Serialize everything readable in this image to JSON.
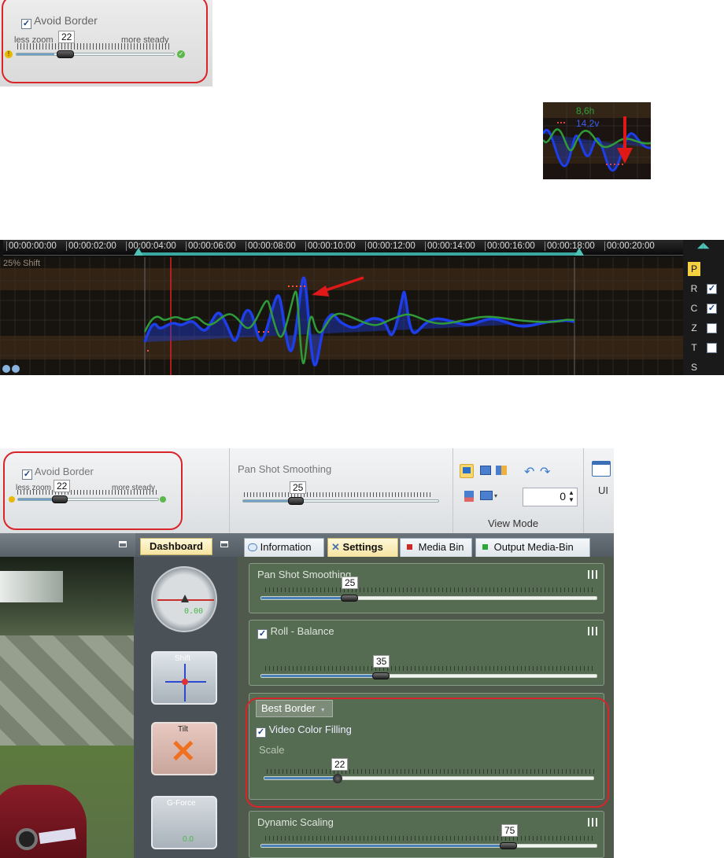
{
  "top_snippet": {
    "checkbox_label": "Avoid Border",
    "left_label": "less zoom",
    "right_label": "more steady",
    "value": "22",
    "value_fraction": 0.24
  },
  "thumb_graph": {
    "h_value": "8,6h",
    "v_value": "14,2v"
  },
  "timeline": {
    "times": [
      "00:00:00:00",
      "00:00:02:00",
      "00:00:04:00",
      "00:00:06:00",
      "00:00:08:00",
      "00:00:10:00",
      "00:00:12:00",
      "00:00:14:00",
      "00:00:16:00",
      "00:00:18:00",
      "00:00:20:00"
    ],
    "shift_label": "25% Shift",
    "side_items": [
      {
        "letter": "P",
        "checked": null,
        "active": true
      },
      {
        "letter": "R",
        "checked": true,
        "active": false
      },
      {
        "letter": "C",
        "checked": true,
        "active": false
      },
      {
        "letter": "Z",
        "checked": false,
        "active": false
      },
      {
        "letter": "T",
        "checked": false,
        "active": false
      },
      {
        "letter": "S",
        "checked": null,
        "active": false
      }
    ],
    "colors": {
      "green": "#2e9a3a",
      "blue": "#1d3ee8",
      "red": "#e02020"
    }
  },
  "toolbar": {
    "avoid_border": {
      "label": "Avoid Border",
      "left": "less zoom",
      "right": "more steady",
      "value": "22",
      "fraction": 0.24
    },
    "pan_shot": {
      "title": "Pan Shot Smoothing",
      "value": "25",
      "fraction": 0.27
    },
    "view_mode_label": "View Mode",
    "counter_value": "0",
    "ui_label": "UI"
  },
  "dashboard": {
    "tab_label": "Dashboard",
    "gauge_readout": "0.00",
    "shift_label": "Shift",
    "tilt_label": "Tilt",
    "gforce_label": "G-Force",
    "gforce_readout": "0.0"
  },
  "tabs": [
    {
      "label": "Information",
      "icon": "speech-bubble-icon"
    },
    {
      "label": "Settings",
      "icon": "tools-icon"
    },
    {
      "label": "Media Bin",
      "icon": "red-square-icon"
    },
    {
      "label": "Output Media-Bin",
      "icon": "green-square-icon"
    }
  ],
  "settings": {
    "pan_shot": {
      "title": "Pan Shot Smoothing",
      "value": "25",
      "fraction": 0.25
    },
    "roll_balance": {
      "title": "Roll - Balance",
      "value": "35",
      "fraction": 0.35
    },
    "border": {
      "dropdown": "Best Border",
      "filling_label": "Video Color Filling",
      "scale_label": "Scale",
      "value": "22",
      "fraction": 0.22
    },
    "dynamic_scaling": {
      "title": "Dynamic Scaling",
      "value": "75",
      "fraction": 0.75
    }
  }
}
